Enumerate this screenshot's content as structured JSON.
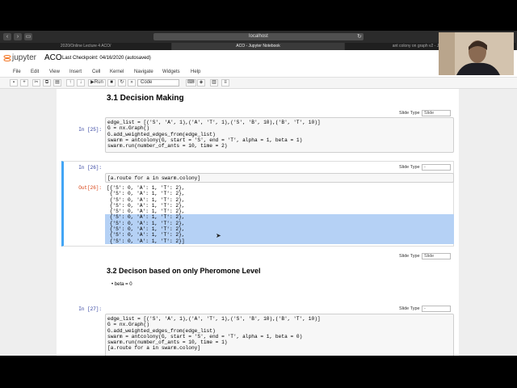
{
  "browser": {
    "address": "localhost",
    "tabs": [
      "2020/Online Lecture 4 ACO/",
      "ACO - Jupyter Notebook",
      "ant colony on graph v2 - Jupyter Notebook"
    ]
  },
  "jupyter": {
    "logo_text": "jupyter",
    "title": "ACO",
    "checkpoint": "Last Checkpoint: 04/16/2020  (autosaved)"
  },
  "menu": [
    "File",
    "Edit",
    "View",
    "Insert",
    "Cell",
    "Kernel",
    "Navigate",
    "Widgets",
    "Help"
  ],
  "toolbar": {
    "run_label": "Run",
    "cell_type": "Code"
  },
  "cells": {
    "h1": "3.1  Decision Making",
    "c25": {
      "prompt": "In [25]:",
      "slide_label": "Slide Type",
      "slide_value": "Slide",
      "lines": [
        "edge_list = [('S', 'A', 1),('A', 'T', 1),('S', 'B', 10),('B', 'T', 10)]",
        "G = nx.Graph()",
        "G.add_weighted_edges_from(edge_list)",
        "",
        "swarm = antcolony(G, start = 'S', end = 'T', alpha = 1, beta = 1)",
        "swarm.run(number_of_ants = 10, time = 2)"
      ]
    },
    "c26": {
      "prompt": "In [26]:",
      "slide_label": "Slide Type",
      "slide_value": "-",
      "code": "[a.route for a in swarm.colony]",
      "out_prompt": "Out[26]:",
      "out_lines": [
        "[{'S': 0, 'A': 1, 'T': 2},",
        " {'S': 0, 'A': 1, 'T': 2},",
        " {'S': 0, 'A': 1, 'T': 2},",
        " {'S': 0, 'A': 1, 'T': 2},",
        " {'S': 0, 'A': 1, 'T': 2},",
        " {'S': 0, 'A': 1, 'T': 2},",
        " {'S': 0, 'A': 1, 'T': 2},",
        " {'S': 0, 'A': 1, 'T': 2},",
        " {'S': 0, 'A': 1, 'T': 2},",
        " {'S': 0, 'A': 1, 'T': 2}]"
      ]
    },
    "md32": {
      "slide_label": "Slide Type",
      "slide_value": "Slide",
      "heading": "3.2  Decison based on only Pheromone Level",
      "bullet": "beta = 0"
    },
    "c27": {
      "prompt": "In [27]:",
      "slide_label": "Slide Type",
      "slide_value": "-",
      "lines": [
        "edge_list = [('S', 'A', 1),('A', 'T', 1),('S', 'B', 10),('B', 'T', 10)]",
        "G = nx.Graph()",
        "G.add_weighted_edges_from(edge_list)",
        "",
        "swarm = antcolony(G, start = 'S', end = 'T', alpha = 1, beta = 0)",
        "swarm.run(number_of_ants = 10, time = 1)",
        "",
        "[a.route for a in swarm.colony]"
      ]
    }
  }
}
